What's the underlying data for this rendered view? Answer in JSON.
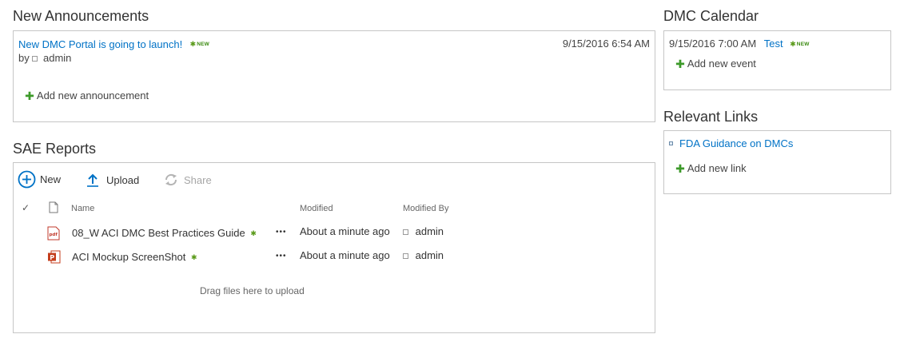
{
  "announcements": {
    "title": "New Announcements",
    "item": {
      "title": "New DMC Portal is going to launch!",
      "badge": "NEW",
      "by_label": "by",
      "author": "admin",
      "date": "9/15/2016 6:54 AM"
    },
    "add_label": "Add new announcement"
  },
  "calendar": {
    "title": "DMC Calendar",
    "event": {
      "datetime": "9/15/2016 7:00 AM",
      "title": "Test",
      "badge": "NEW"
    },
    "add_label": "Add new event"
  },
  "links": {
    "title": "Relevant Links",
    "items": [
      {
        "label": "FDA Guidance on DMCs"
      }
    ],
    "add_label": "Add new link"
  },
  "reports": {
    "title": "SAE Reports",
    "toolbar": {
      "new_label": "New",
      "upload_label": "Upload",
      "share_label": "Share"
    },
    "columns": {
      "name": "Name",
      "modified": "Modified",
      "modified_by": "Modified By"
    },
    "rows": [
      {
        "name": "08_W ACI DMC Best Practices Guide",
        "file_type": "pdf",
        "modified": "About a minute ago",
        "modified_by": "admin",
        "more": "•••"
      },
      {
        "name": "ACI Mockup ScreenShot",
        "file_type": "pptx",
        "modified": "About a minute ago",
        "modified_by": "admin",
        "more": "•••"
      }
    ],
    "drop_hint": "Drag files here to upload"
  },
  "colors": {
    "link": "#0072c6",
    "new_badge": "#3a8a10",
    "add_plus": "#3d9a2a",
    "panel_border": "#c6c6c6"
  }
}
